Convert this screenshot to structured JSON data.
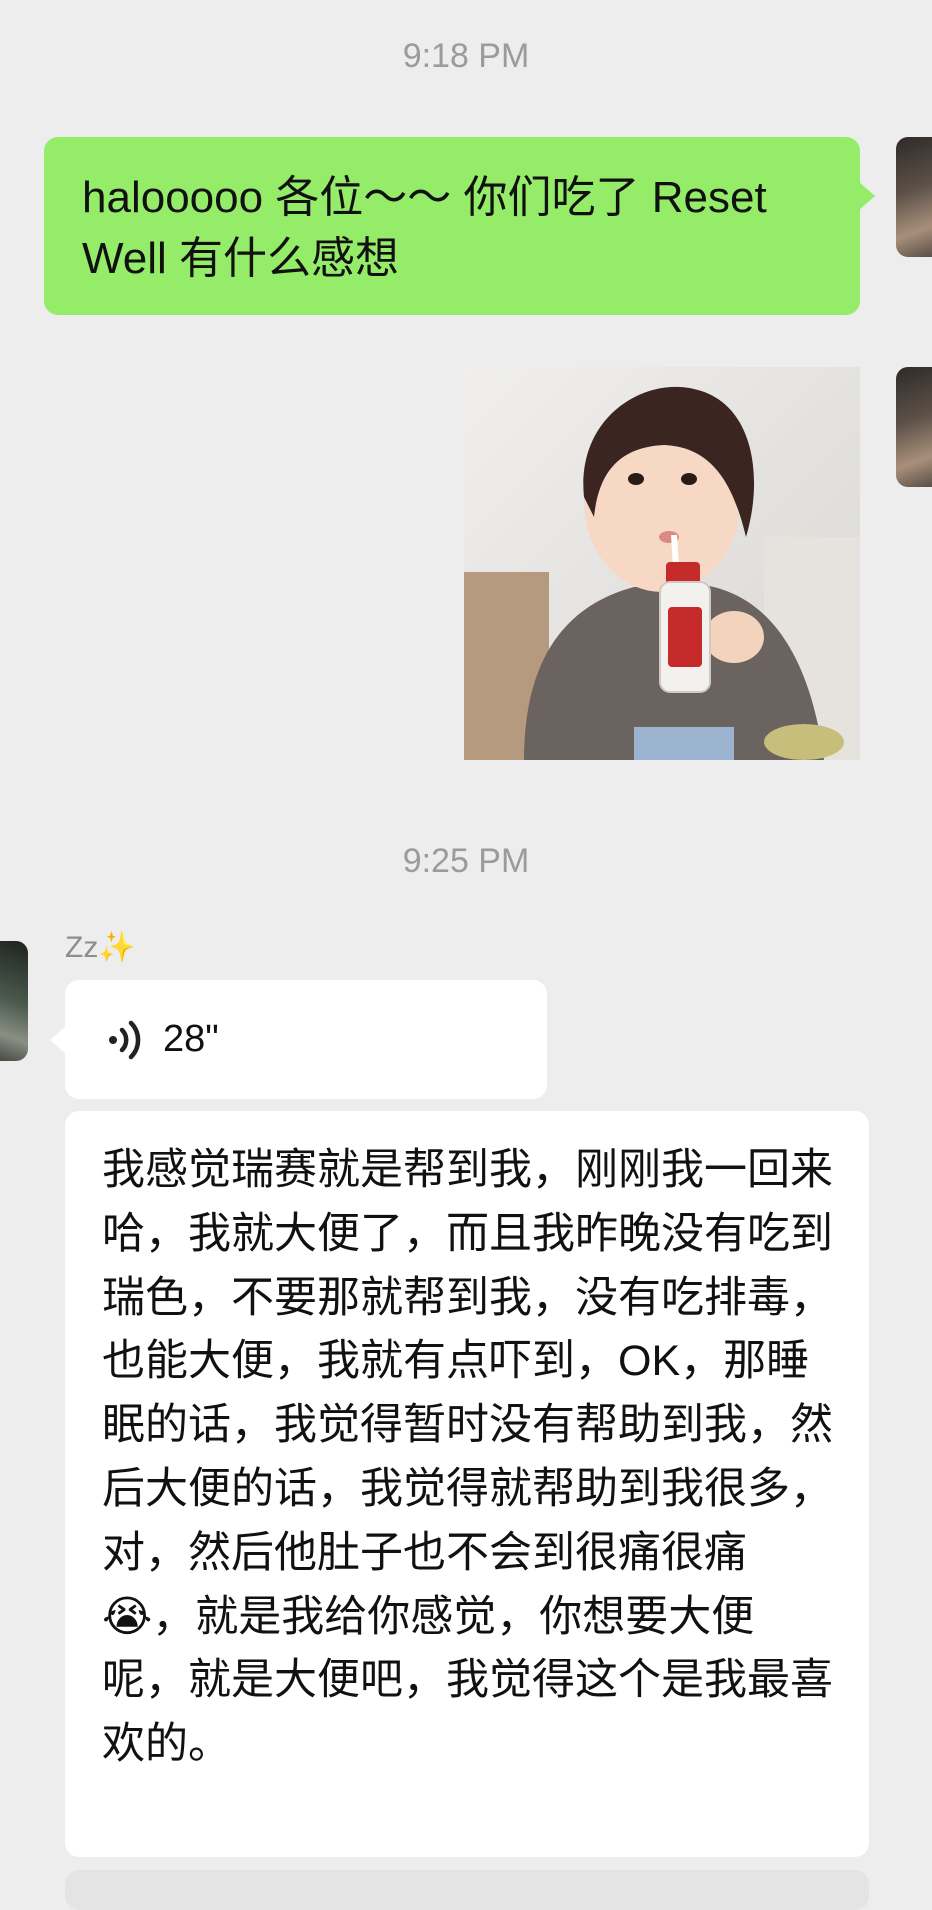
{
  "chat": {
    "time_1": "9:18 PM",
    "time_2": "9:25 PM",
    "outgoing_message": "halooooo 各位～～ 你们吃了 Reset Well 有什么感想",
    "sender_name": "Zz✨",
    "voice_duration": "28\"",
    "transcript": "我感觉瑞赛就是帮到我，刚刚我一回来哈，我就大便了，而且我昨晚没有吃到瑞色，不要那就帮到我，没有吃排毒，也能大便，我就有点吓到，OK，那睡眠的话，我觉得暂时没有帮助到我，然后大便的话，我觉得就帮助到我很多，对，然后他肚子也不会到很痛很痛😭，就是我给你感觉，你想要大便呢，就是大便吧，我觉得这个是我最喜欢的。"
  },
  "colors": {
    "background": "#ededed",
    "outgoing_bubble": "#95ec69",
    "incoming_bubble": "#ffffff",
    "timestamp_text": "#9b9b9b"
  },
  "icons": {
    "voice": "voice-wave-icon"
  }
}
